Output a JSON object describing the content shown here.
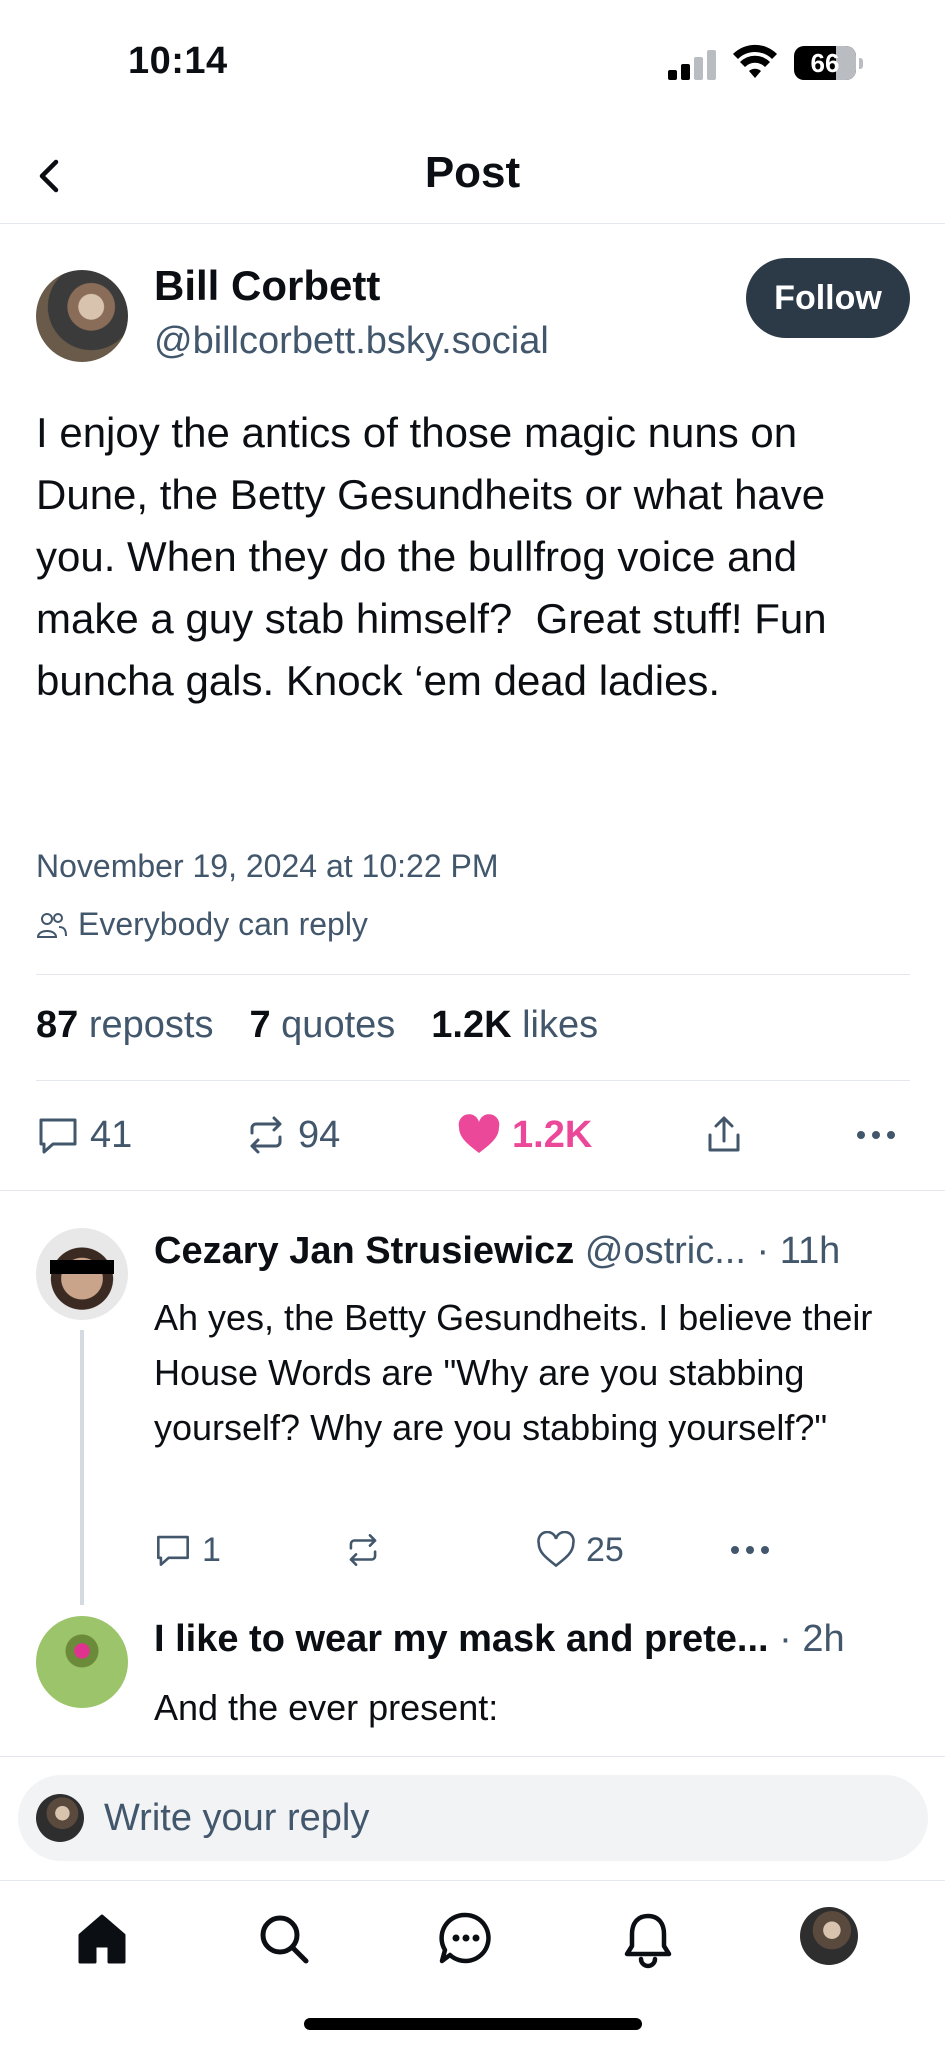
{
  "status_bar": {
    "time": "10:14",
    "battery": "66"
  },
  "header": {
    "title": "Post"
  },
  "post": {
    "author_name": "Bill Corbett",
    "author_handle": "@billcorbett.bsky.social",
    "follow_label": "Follow",
    "text": "I enjoy the antics of those magic nuns on Dune, the Betty Gesundheits or what have you. When they do the bullfrog voice and make a guy stab himself?  Great stuff! Fun buncha gals. Knock ‘em dead ladies.",
    "timestamp": "November 19, 2024 at 10:22 PM",
    "reply_setting": "Everybody can reply",
    "stats": {
      "reposts_count": "87",
      "reposts_label": "reposts",
      "quotes_count": "7",
      "quotes_label": "quotes",
      "likes_count": "1.2K",
      "likes_label": "likes"
    },
    "actions": {
      "replies": "41",
      "reposts": "94",
      "likes": "1.2K"
    },
    "like_color": "#ec4899"
  },
  "replies": [
    {
      "name": "Cezary Jan Strusiewicz",
      "handle": "@ostric...",
      "time": "· 11h",
      "text": "Ah yes, the Betty Gesundheits. I believe their House Words are \"Why are you stabbing yourself? Why are you stabbing yourself?\"",
      "replies": "1",
      "likes": "25"
    },
    {
      "name": "I like to wear my mask and prete...",
      "time": "· 2h",
      "text": "And the ever present:"
    }
  ],
  "composer": {
    "placeholder": "Write your reply"
  },
  "tabs": [
    "home-icon",
    "search-icon",
    "chat-icon",
    "bell-icon",
    "profile-avatar"
  ]
}
